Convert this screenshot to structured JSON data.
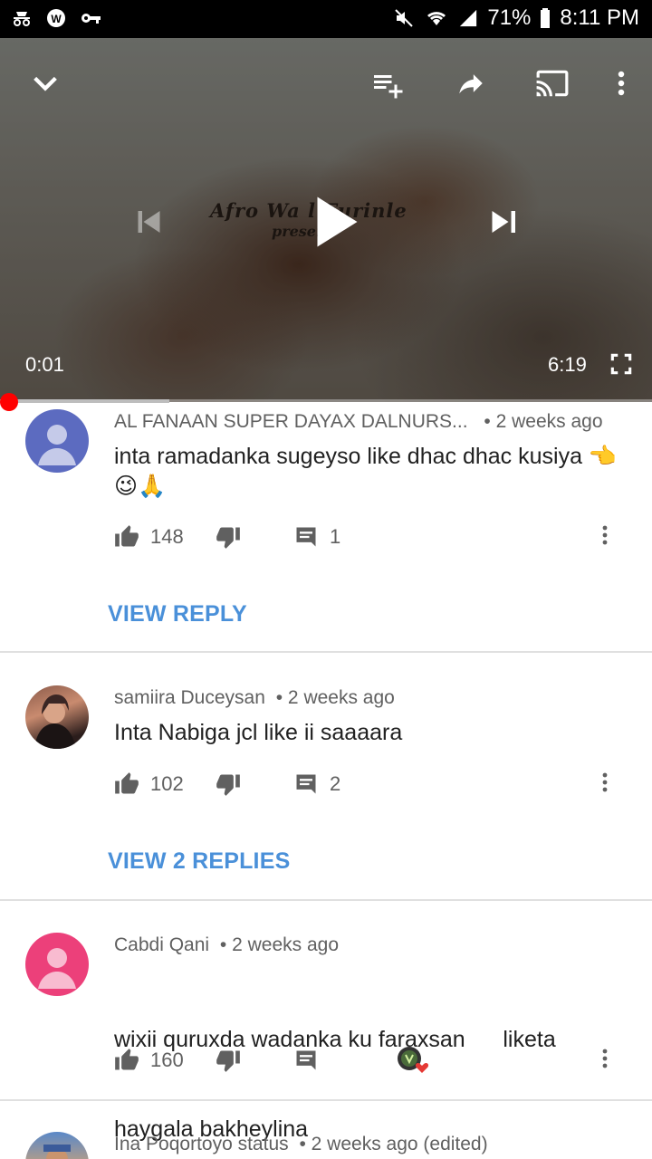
{
  "status_bar": {
    "battery": "71%",
    "time": "8:11 PM",
    "icons": [
      "incognito-icon",
      "whatsapp-icon",
      "key-icon",
      "mute-icon",
      "wifi-icon",
      "signal-icon",
      "battery-icon"
    ]
  },
  "player": {
    "overlay_title": "Afro Wa   l Furinle",
    "overlay_sub": "present",
    "current_time": "0:01",
    "duration": "6:19",
    "progress_fraction": 0.003,
    "buffer_fraction": 0.26,
    "accent": "#ff0000"
  },
  "comments": [
    {
      "author": "AL FANAAN SUPER DAYAX DALNURS...",
      "time": "• 2 weeks ago",
      "text": "inta ramadanka sugeyso like dhac dhac kusiya 👈😉🙏",
      "likes": "148",
      "replies": "1",
      "view_replies": "VIEW REPLY",
      "avatar": "default-blue"
    },
    {
      "author": "samiira Duceysan",
      "time": "• 2 weeks ago",
      "text": "Inta Nabiga jcl like ii saaaara",
      "likes": "102",
      "replies": "2",
      "view_replies": "VIEW 2 REPLIES",
      "avatar": "photo"
    },
    {
      "author": "Cabdi Qani",
      "time": "• 2 weeks ago",
      "text_line1": "wixii quruxda wadanka ku faraxsan      liketa",
      "text_line2": "haygala bakheylina",
      "likes": "160",
      "avatar": "default-pink"
    },
    {
      "author": "Ina Poqortoyo status",
      "time": "• 2 weeks ago (edited)",
      "avatar": "photo"
    }
  ],
  "colors": {
    "link_blue": "#4a90d9",
    "avatar_blue": "#5c6bc0",
    "avatar_pink": "#ec407a",
    "heart_red": "#e53935"
  }
}
